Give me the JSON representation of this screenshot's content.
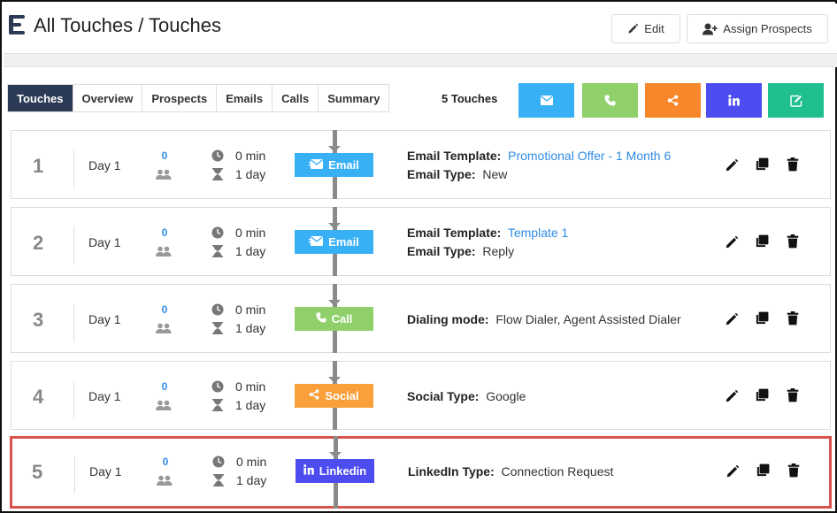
{
  "header": {
    "title": "All Touches / Touches",
    "edit_label": "Edit",
    "assign_label": "Assign Prospects"
  },
  "tabs": [
    {
      "label": "Touches",
      "active": true
    },
    {
      "label": "Overview",
      "active": false
    },
    {
      "label": "Prospects",
      "active": false
    },
    {
      "label": "Emails",
      "active": false
    },
    {
      "label": "Calls",
      "active": false
    },
    {
      "label": "Summary",
      "active": false
    }
  ],
  "touch_count": "5 Touches",
  "add_buttons": [
    {
      "name": "add-email-touch",
      "icon": "envelope-icon",
      "color": "#38b0f5"
    },
    {
      "name": "add-call-touch",
      "icon": "phone-icon",
      "color": "#8fd06a"
    },
    {
      "name": "add-social-touch",
      "icon": "share-icon",
      "color": "#f7872a"
    },
    {
      "name": "add-linkedin-touch",
      "icon": "linkedin-icon",
      "color": "#4c4cf0"
    },
    {
      "name": "add-task-touch",
      "icon": "edit-icon",
      "color": "#1fbf8f"
    }
  ],
  "touches": [
    {
      "num": "1",
      "day": "Day 1",
      "prospects": "0",
      "time": "0 min",
      "wait": "1 day",
      "type": "Email",
      "type_color": "#38b0f5",
      "type_icon": "envelope-icon",
      "lines": [
        {
          "label": "Email Template:",
          "value": "Promotional Offer - 1 Month 6",
          "link": true
        },
        {
          "label": "Email Type:",
          "value": "New",
          "link": false
        }
      ]
    },
    {
      "num": "2",
      "day": "Day 1",
      "prospects": "0",
      "time": "0 min",
      "wait": "1 day",
      "type": "Email",
      "type_color": "#38b0f5",
      "type_icon": "envelope-icon",
      "lines": [
        {
          "label": "Email Template:",
          "value": "Template 1",
          "link": true
        },
        {
          "label": "Email Type:",
          "value": "Reply",
          "link": false
        }
      ]
    },
    {
      "num": "3",
      "day": "Day 1",
      "prospects": "0",
      "time": "0 min",
      "wait": "1 day",
      "type": "Call",
      "type_color": "#8fd06a",
      "type_icon": "phone-icon",
      "lines": [
        {
          "label": "Dialing mode:",
          "value": "Flow Dialer, Agent Assisted Dialer",
          "link": false
        }
      ]
    },
    {
      "num": "4",
      "day": "Day 1",
      "prospects": "0",
      "time": "0 min",
      "wait": "1 day",
      "type": "Social",
      "type_color": "#f9a03a",
      "type_icon": "share-icon",
      "lines": [
        {
          "label": "Social Type:",
          "value": "Google",
          "link": false
        }
      ]
    },
    {
      "num": "5",
      "day": "Day 1",
      "prospects": "0",
      "time": "0 min",
      "wait": "1 day",
      "type": "Linkedin",
      "type_color": "#4c4cf0",
      "type_icon": "linkedin-icon",
      "lines": [
        {
          "label": "LinkedIn Type:",
          "value": "Connection Request",
          "link": false
        }
      ]
    }
  ]
}
